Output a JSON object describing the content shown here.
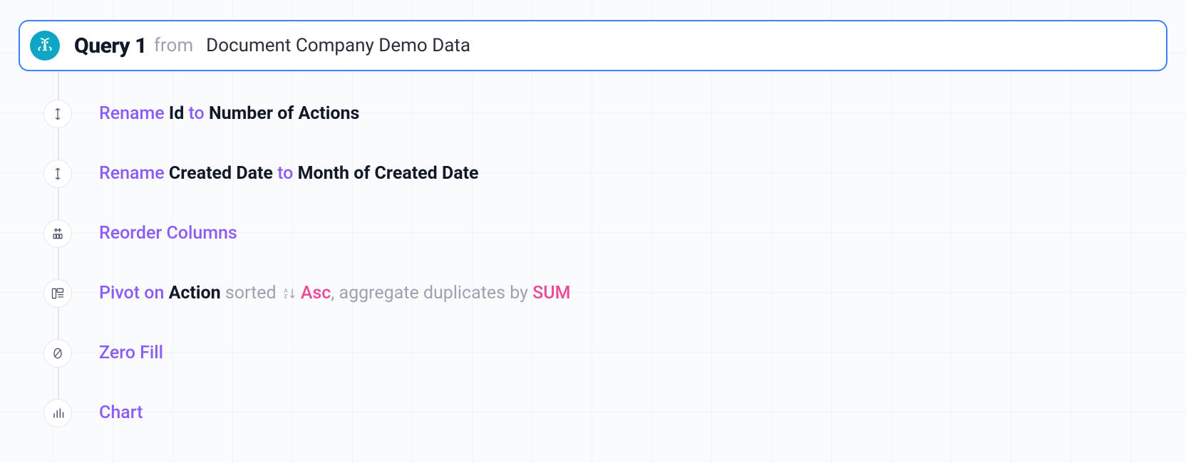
{
  "header": {
    "query_title": "Query 1",
    "from_keyword": "from",
    "source": "Document Company Demo Data"
  },
  "steps": [
    {
      "icon": "rename",
      "parts": {
        "action": "Rename",
        "from_value": "Id",
        "to_kw": "to",
        "to_value": "Number of Actions"
      }
    },
    {
      "icon": "rename",
      "parts": {
        "action": "Rename",
        "from_value": "Created Date",
        "to_kw": "to",
        "to_value": "Month of Created Date"
      }
    },
    {
      "icon": "reorder",
      "parts": {
        "action": "Reorder Columns"
      }
    },
    {
      "icon": "pivot",
      "parts": {
        "action": "Pivot on",
        "pivot_col": "Action",
        "sorted_kw": "sorted",
        "sort_dir": "Asc",
        "agg_prefix": ", aggregate duplicates by",
        "agg_fn": "SUM"
      }
    },
    {
      "icon": "zerofill",
      "parts": {
        "action": "Zero Fill"
      }
    },
    {
      "icon": "chart",
      "parts": {
        "action": "Chart"
      }
    }
  ]
}
